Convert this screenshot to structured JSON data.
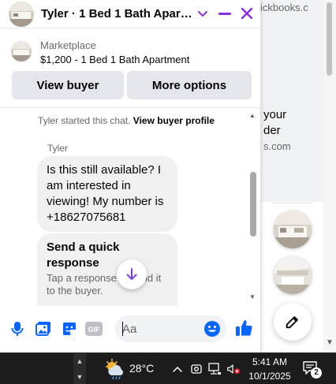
{
  "chat": {
    "title": "Tyler · 1 Bed 1 Bath Apartm...",
    "marketplace_label": "Marketplace",
    "listing_title": "$1,200 - 1 Bed 1 Bath Apartment",
    "view_buyer_label": "View buyer",
    "more_options_label": "More options",
    "system_message": "Tyler started this chat.",
    "view_profile_link": "View buyer profile",
    "sender_name": "Tyler",
    "message_text": "Is this still available? I am interested in viewing! My number is +18627075681",
    "quick_response_title": "Send a quick response",
    "quick_response_sub": "Tap a response to send it to the buyer.",
    "composer_placeholder": "Aa",
    "accent_color": "#8a2be2",
    "messenger_blue": "#0866ff",
    "icons": [
      "chevron-down-icon",
      "minimize-icon",
      "close-icon",
      "microphone-icon",
      "photo-icon",
      "sticker-icon",
      "gif-icon",
      "emoji-icon",
      "thumbs-up-icon",
      "arrow-down-icon"
    ]
  },
  "background_page": {
    "url_fragment": "ickbooks.c",
    "heading_line_1": "your",
    "heading_line_2": "der",
    "sub_line": "s.com"
  },
  "taskbar": {
    "temperature": "28°C",
    "time": "5:41 AM",
    "date": "10/1/2025",
    "notification_count": "2",
    "icons": [
      "weather-icon",
      "tray-chevron-up-icon",
      "camera-icon",
      "network-icon",
      "volume-muted-icon",
      "notification-icon"
    ]
  }
}
